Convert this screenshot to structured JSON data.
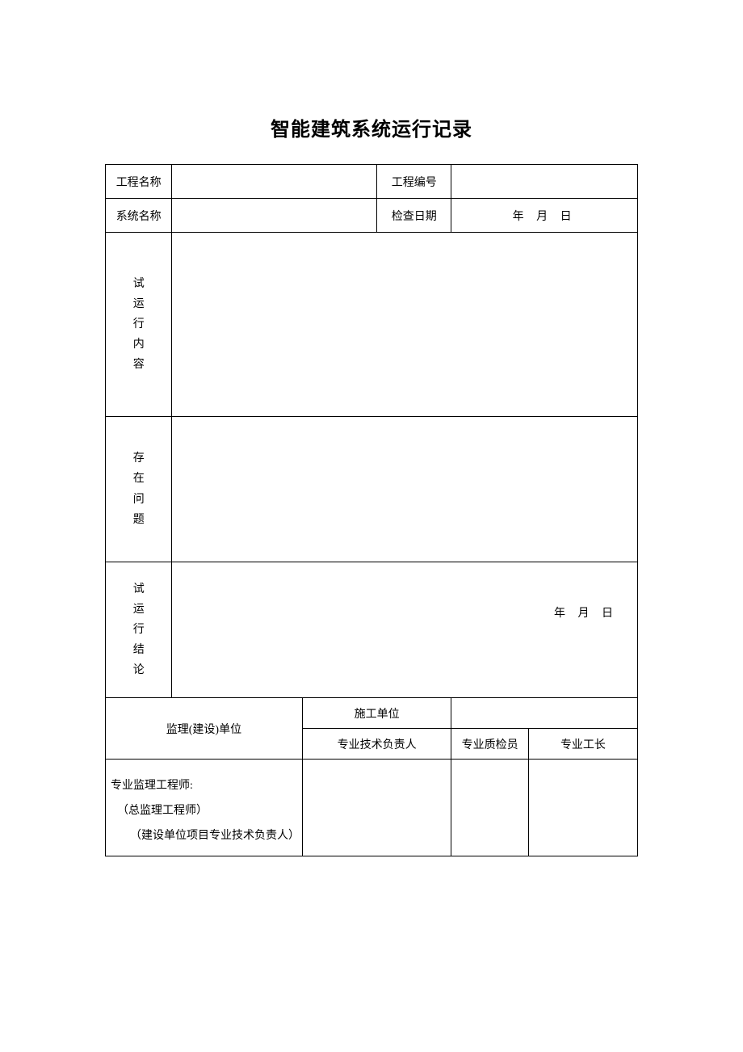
{
  "title": "智能建筑系统运行记录",
  "labels": {
    "project_name": "工程名称",
    "project_no": "工程编号",
    "system_name": "系统名称",
    "check_date": "检查日期",
    "trial_content": "试\n运\n行\n内\n容",
    "issues": "存\n在\n问\n题",
    "conclusion": "试\n运\n行\n结\n论",
    "supervision_unit": "监理(建设)单位",
    "construction_unit": "施工单位",
    "tech_lead": "专业技术负责人",
    "qc_inspector": "专业质检员",
    "foreman": "专业工长",
    "sig_line1": "专业监理工程师:",
    "sig_line2": "（总监理工程师）",
    "sig_line3": "（建设单位项目专业技术负责人）"
  },
  "values": {
    "project_name": "",
    "project_no": "",
    "system_name": "",
    "check_date": "年 月 日",
    "trial_content": "",
    "issues": "",
    "conclusion_date": "年 月 日",
    "construction_unit": "",
    "tech_lead": "",
    "qc_inspector": "",
    "foreman": ""
  }
}
